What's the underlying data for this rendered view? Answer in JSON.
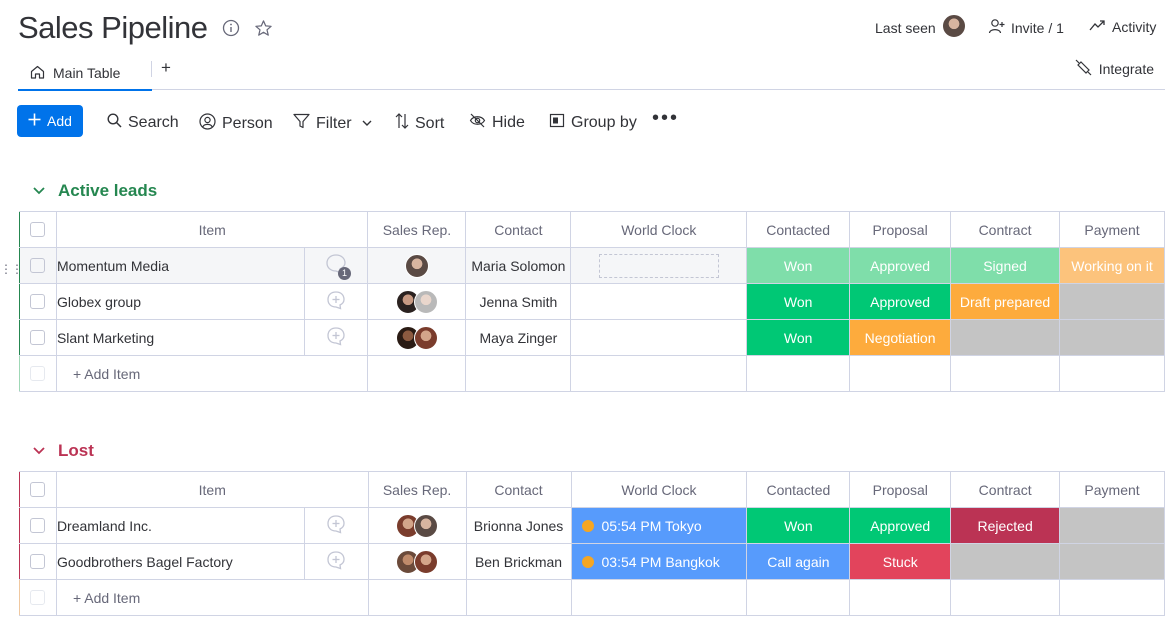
{
  "header": {
    "title": "Sales Pipeline",
    "last_seen_label": "Last seen",
    "invite_label": "Invite / 1",
    "activity_label": "Activity"
  },
  "tabs": {
    "main_label": "Main Table",
    "add_label": "+",
    "integrate_label": "Integrate"
  },
  "toolbar": {
    "add_label": "Add",
    "search_label": "Search",
    "person_label": "Person",
    "filter_label": "Filter",
    "sort_label": "Sort",
    "hide_label": "Hide",
    "group_by_label": "Group by"
  },
  "columns": {
    "item": "Item",
    "sales_rep": "Sales Rep.",
    "contact": "Contact",
    "world_clock": "World Clock",
    "contacted": "Contacted",
    "proposal": "Proposal",
    "contract": "Contract",
    "payment": "Payment"
  },
  "colors": {
    "active_group": "#258750",
    "lost_group": "#bb3354",
    "won": "#00c875",
    "won_light": "#7fdeaa",
    "approved": "#00c875",
    "approved_light": "#7fdeaa",
    "signed_light": "#7fdeaa",
    "working_on_it_light": "#fcc37c",
    "draft_prepared": "#fdab3d",
    "negotiation": "#fdab3d",
    "rejected": "#bb3354",
    "call_again": "#579bfc",
    "stuck": "#e2445c",
    "empty": "#c4c4c4",
    "clock": "#579bfc"
  },
  "groups": [
    {
      "name": "Active leads",
      "add_item_label": "+ Add Item",
      "rows": [
        {
          "item": "Momentum Media",
          "comment_count": "1",
          "contact": "Maria Solomon",
          "world_clock": "",
          "contacted": "Won",
          "proposal": "Approved",
          "contract": "Signed",
          "payment": "Working on it"
        },
        {
          "item": "Globex group",
          "contact": "Jenna Smith",
          "world_clock": "",
          "contacted": "Won",
          "proposal": "Approved",
          "contract": "Draft prepared",
          "payment": ""
        },
        {
          "item": "Slant Marketing",
          "contact": "Maya Zinger",
          "world_clock": "",
          "contacted": "Won",
          "proposal": "Negotiation",
          "contract": "",
          "payment": ""
        }
      ]
    },
    {
      "name": "Lost",
      "add_item_label": "+ Add Item",
      "rows": [
        {
          "item": "Dreamland Inc.",
          "contact": "Brionna Jones",
          "world_clock": "05:54 PM Tokyo",
          "contacted": "Won",
          "proposal": "Approved",
          "contract": "Rejected",
          "payment": ""
        },
        {
          "item": "Goodbrothers Bagel Factory",
          "contact": "Ben Brickman",
          "world_clock": "03:54 PM Bangkok",
          "contacted": "Call again",
          "proposal": "Stuck",
          "contract": "",
          "payment": ""
        }
      ]
    }
  ]
}
